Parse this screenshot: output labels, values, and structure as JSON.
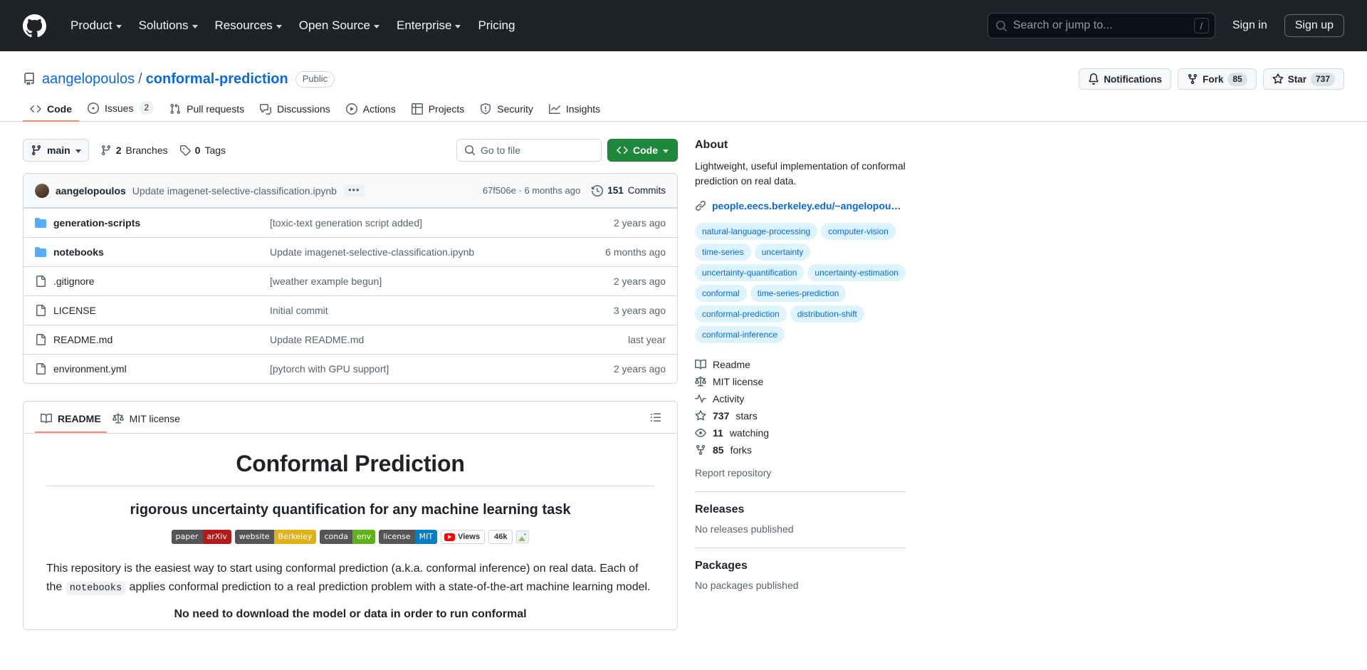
{
  "header": {
    "logo_icon": "github-mark-icon",
    "nav": [
      {
        "label": "Product",
        "has_caret": true
      },
      {
        "label": "Solutions",
        "has_caret": true
      },
      {
        "label": "Resources",
        "has_caret": true
      },
      {
        "label": "Open Source",
        "has_caret": true
      },
      {
        "label": "Enterprise",
        "has_caret": true
      },
      {
        "label": "Pricing",
        "has_caret": false
      }
    ],
    "search": {
      "placeholder": "Search or jump to...",
      "shortcut": "/",
      "icon": "search-icon"
    },
    "sign_in": "Sign in",
    "sign_up": "Sign up"
  },
  "repo": {
    "icon": "repo-icon",
    "owner": "aangelopoulos",
    "separator": "/",
    "name": "conformal-prediction",
    "visibility": "Public",
    "actions": {
      "notifications": "Notifications",
      "fork_label": "Fork",
      "fork_count": "85",
      "star_label": "Star",
      "star_count": "737"
    },
    "tabs": [
      {
        "label": "Code",
        "icon": "code-icon",
        "count": "",
        "active": true
      },
      {
        "label": "Issues",
        "icon": "issue-opened-icon",
        "count": "2",
        "active": false
      },
      {
        "label": "Pull requests",
        "icon": "git-pull-request-icon",
        "count": "",
        "active": false
      },
      {
        "label": "Discussions",
        "icon": "comment-discussion-icon",
        "count": "",
        "active": false
      },
      {
        "label": "Actions",
        "icon": "play-icon",
        "count": "",
        "active": false
      },
      {
        "label": "Projects",
        "icon": "table-icon",
        "count": "",
        "active": false
      },
      {
        "label": "Security",
        "icon": "shield-icon",
        "count": "",
        "active": false
      },
      {
        "label": "Insights",
        "icon": "graph-icon",
        "count": "",
        "active": false
      }
    ]
  },
  "toolbar": {
    "branch": "main",
    "branches_count": "2",
    "branches_label": "Branches",
    "tags_count": "0",
    "tags_label": "Tags",
    "go_to_file_placeholder": "Go to file",
    "code_button": "Code"
  },
  "commit_bar": {
    "author": "aangelopoulos",
    "message": "Update imagenet-selective-classification.ipynb",
    "more": "•••",
    "sha": "67f506e",
    "sha_separator": "·",
    "time": "6 months ago",
    "commits_count": "151",
    "commits_label": "Commits"
  },
  "files": [
    {
      "type": "dir",
      "name": "generation-scripts",
      "message": "[toxic-text generation script added]",
      "time": "2 years ago"
    },
    {
      "type": "dir",
      "name": "notebooks",
      "message": "Update imagenet-selective-classification.ipynb",
      "time": "6 months ago"
    },
    {
      "type": "file",
      "name": ".gitignore",
      "message": "[weather example begun]",
      "time": "2 years ago"
    },
    {
      "type": "file",
      "name": "LICENSE",
      "message": "Initial commit",
      "time": "3 years ago"
    },
    {
      "type": "file",
      "name": "README.md",
      "message": "Update README.md",
      "time": "last year"
    },
    {
      "type": "file",
      "name": "environment.yml",
      "message": "[pytorch with GPU support]",
      "time": "2 years ago"
    }
  ],
  "readme": {
    "tabs": [
      {
        "label": "README",
        "icon": "book-icon",
        "active": true
      },
      {
        "label": "MIT license",
        "icon": "law-icon",
        "active": false
      }
    ],
    "outline_icon": "list-unordered-icon",
    "title": "Conformal Prediction",
    "subtitle": "rigorous uncertainty quantification for any machine learning task",
    "badges": [
      {
        "left": "paper",
        "right": "arXiv",
        "right_color": "#b31b1b"
      },
      {
        "left": "website",
        "right": "Berkeley",
        "right_color": "#dfb317"
      },
      {
        "left": "conda",
        "right": "env",
        "right_color": "#5fb319"
      },
      {
        "left": "license",
        "right": "MIT",
        "right_color": "#007ec6"
      }
    ],
    "views_badge": {
      "label": "Views",
      "count": "46k",
      "icon": "youtube-icon"
    },
    "broken_image_icon": "broken-image-icon",
    "paragraph_1a": "This repository is the easiest way to start using conformal prediction (a.k.a. conformal inference) on real data. Each of the ",
    "paragraph_1_code": "notebooks",
    "paragraph_1b": " applies conformal prediction to a real prediction problem with a state-of-the-art machine learning model.",
    "heading_2": "No need to download the model or data in order to run conformal"
  },
  "sidebar": {
    "about_heading": "About",
    "description": "Lightweight, useful implementation of conformal prediction on real data.",
    "link_icon": "link-icon",
    "url": "people.eecs.berkeley.edu/~angelopou…",
    "topics": [
      "natural-language-processing",
      "computer-vision",
      "time-series",
      "uncertainty",
      "uncertainty-quantification",
      "uncertainty-estimation",
      "conformal",
      "time-series-prediction",
      "conformal-prediction",
      "distribution-shift",
      "conformal-inference"
    ],
    "stats": [
      {
        "icon": "book-icon",
        "bold": "",
        "text": "Readme"
      },
      {
        "icon": "law-icon",
        "bold": "",
        "text": "MIT license"
      },
      {
        "icon": "pulse-icon",
        "bold": "",
        "text": "Activity"
      },
      {
        "icon": "star-icon",
        "bold": "737",
        "text": "stars"
      },
      {
        "icon": "eye-icon",
        "bold": "11",
        "text": "watching"
      },
      {
        "icon": "fork-icon",
        "bold": "85",
        "text": "forks"
      }
    ],
    "report": "Report repository",
    "releases_heading": "Releases",
    "releases_empty": "No releases published",
    "packages_heading": "Packages",
    "packages_empty": "No packages published"
  },
  "colors": {
    "header_bg": "#1f2328",
    "accent_blue": "#0969da",
    "green_button": "#1f883d",
    "tab_underline": "#fd8c73",
    "topic_bg": "#ddf4ff",
    "border": "#d1d9e0"
  }
}
